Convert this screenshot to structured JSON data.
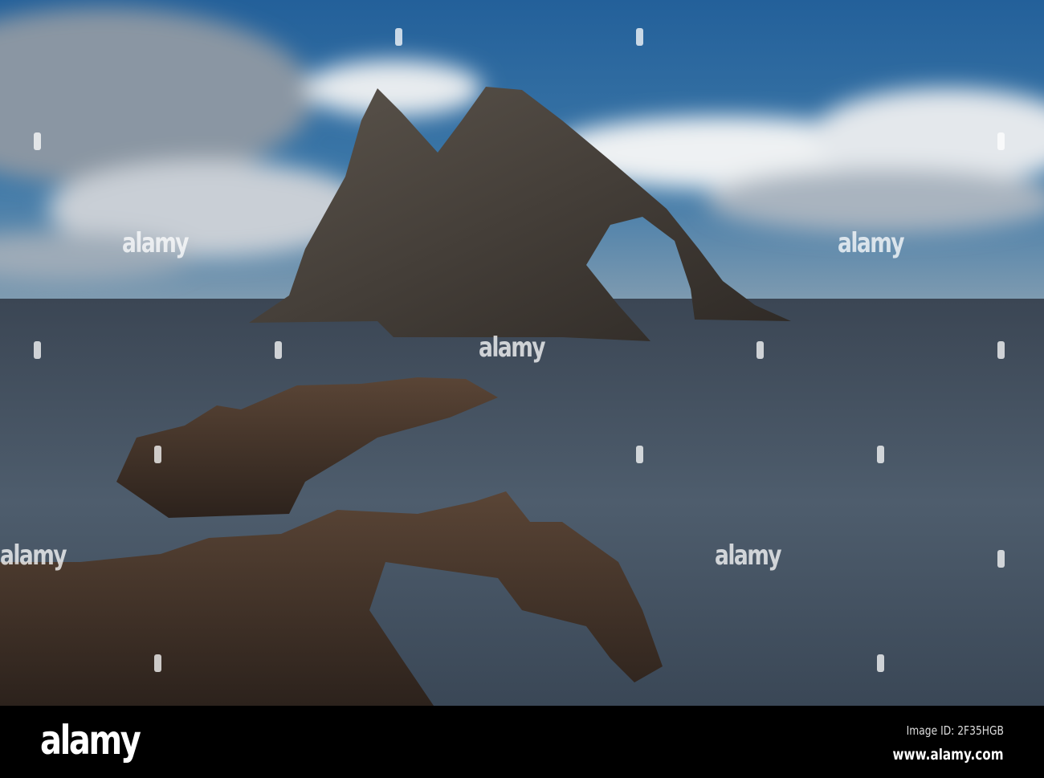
{
  "watermark": {
    "text": "alamy"
  },
  "footer": {
    "logo": "alamy",
    "image_id": "Image ID: 2F35HGB",
    "website": "www.alamy.com"
  },
  "colors": {
    "sky": "#2f6fa8",
    "sea": "#3a4a5c",
    "rock": "#4a3c32",
    "footer": "#000000"
  }
}
